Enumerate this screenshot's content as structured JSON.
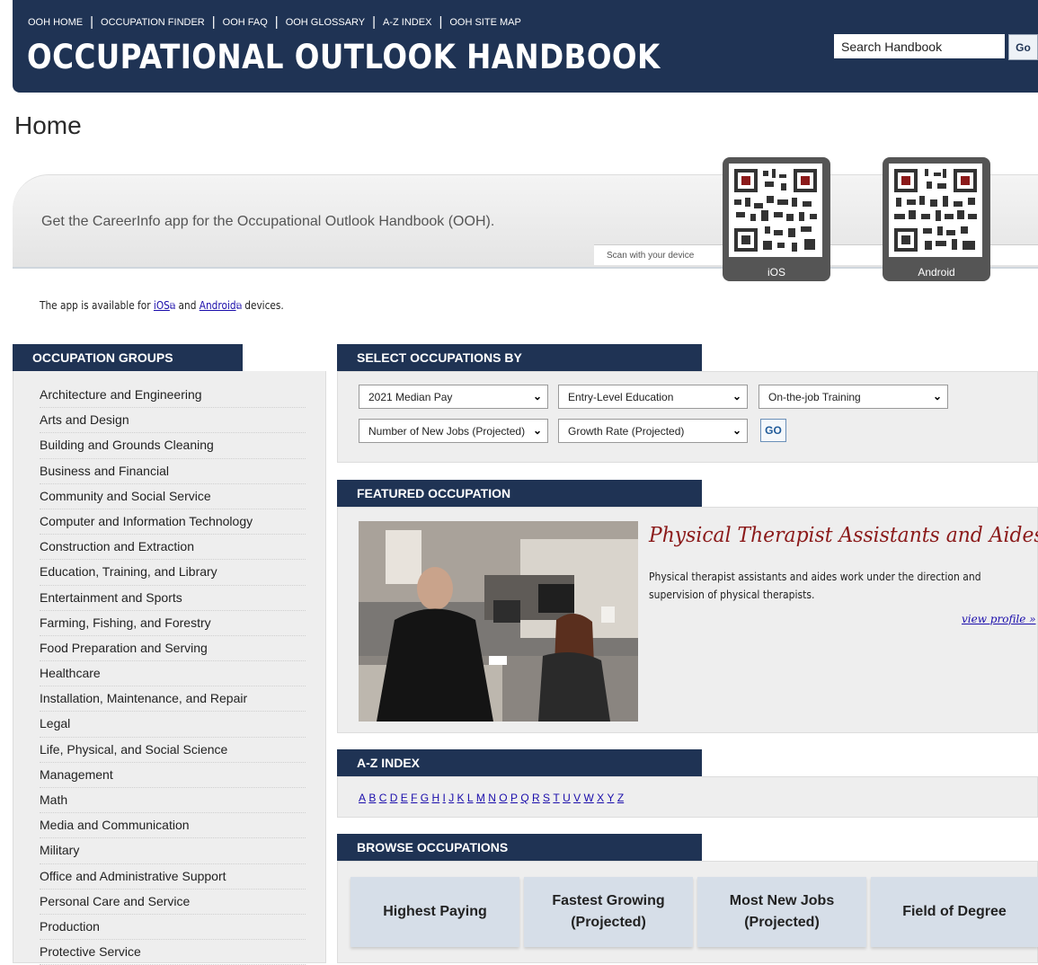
{
  "nav": {
    "links": [
      "OOH HOME",
      "OCCUPATION FINDER",
      "OOH FAQ",
      "OOH GLOSSARY",
      "A-Z INDEX",
      "OOH SITE MAP"
    ],
    "brand": "OCCUPATIONAL OUTLOOK HANDBOOK",
    "search_value": "Search Handbook",
    "search_button": "Go"
  },
  "page_title": "Home",
  "banner": {
    "text": "Get the CareerInfo app for the Occupational Outlook Handbook (OOH).",
    "scan": "Scan with your device",
    "ios_label": "iOS",
    "android_label": "Android"
  },
  "availability": {
    "prefix": "The app is available for ",
    "ios": "iOS",
    "and": " and ",
    "android": "Android",
    "suffix": " devices."
  },
  "groups": {
    "title": "OCCUPATION GROUPS",
    "items": [
      "Architecture and Engineering",
      "Arts and Design",
      "Building and Grounds Cleaning",
      "Business and Financial",
      "Community and Social Service",
      "Computer and Information Technology",
      "Construction and Extraction",
      "Education, Training, and Library",
      "Entertainment and Sports",
      "Farming, Fishing, and Forestry",
      "Food Preparation and Serving",
      "Healthcare",
      "Installation, Maintenance, and Repair",
      "Legal",
      "Life, Physical, and Social Science",
      "Management",
      "Math",
      "Media and Communication",
      "Military",
      "Office and Administrative Support",
      "Personal Care and Service",
      "Production",
      "Protective Service"
    ]
  },
  "select": {
    "title": "SELECT OCCUPATIONS BY",
    "median_pay": "2021 Median Pay",
    "entry_education": "Entry-Level Education",
    "ojt": "On-the-job Training",
    "new_jobs": "Number of New Jobs (Projected)",
    "growth_rate": "Growth Rate (Projected)",
    "go": "GO"
  },
  "featured": {
    "title": "FEATURED OCCUPATION",
    "occupation": "Physical Therapist Assistants and Aides",
    "description": "Physical therapist assistants and aides work under the direction and supervision of physical therapists.",
    "link": "view profile »"
  },
  "az": {
    "title": "A-Z INDEX",
    "letters": [
      "A",
      "B",
      "C",
      "D",
      "E",
      "F",
      "G",
      "H",
      "I",
      "J",
      "K",
      "L",
      "M",
      "N",
      "O",
      "P",
      "Q",
      "R",
      "S",
      "T",
      "U",
      "V",
      "W",
      "X",
      "Y",
      "Z"
    ]
  },
  "browse": {
    "title": "BROWSE OCCUPATIONS",
    "buttons": [
      "Highest Paying",
      "Fastest Growing\n(Projected)",
      "Most New Jobs\n(Projected)",
      "Field of Degree"
    ]
  },
  "colors": {
    "header_navy": "#1f3354",
    "featured_title": "#8b1a1a",
    "link_blue": "#1a0dab",
    "browse_button": "#d6dee8"
  }
}
